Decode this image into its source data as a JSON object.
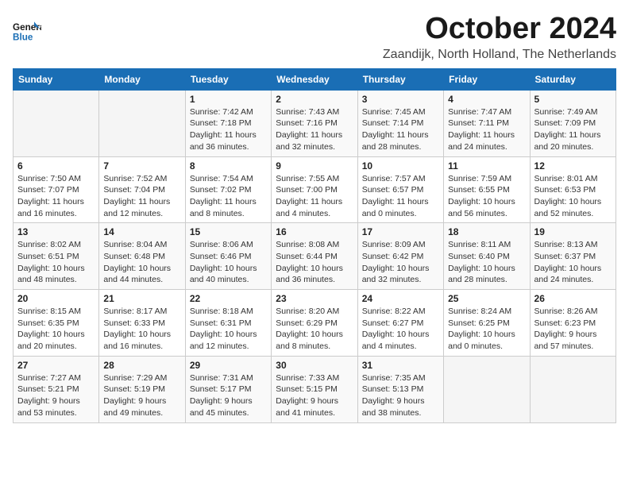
{
  "logo": {
    "line1": "General",
    "line2": "Blue"
  },
  "title": "October 2024",
  "location": "Zaandijk, North Holland, The Netherlands",
  "headers": [
    "Sunday",
    "Monday",
    "Tuesday",
    "Wednesday",
    "Thursday",
    "Friday",
    "Saturday"
  ],
  "weeks": [
    [
      {
        "day": "",
        "info": ""
      },
      {
        "day": "",
        "info": ""
      },
      {
        "day": "1",
        "info": "Sunrise: 7:42 AM\nSunset: 7:18 PM\nDaylight: 11 hours\nand 36 minutes."
      },
      {
        "day": "2",
        "info": "Sunrise: 7:43 AM\nSunset: 7:16 PM\nDaylight: 11 hours\nand 32 minutes."
      },
      {
        "day": "3",
        "info": "Sunrise: 7:45 AM\nSunset: 7:14 PM\nDaylight: 11 hours\nand 28 minutes."
      },
      {
        "day": "4",
        "info": "Sunrise: 7:47 AM\nSunset: 7:11 PM\nDaylight: 11 hours\nand 24 minutes."
      },
      {
        "day": "5",
        "info": "Sunrise: 7:49 AM\nSunset: 7:09 PM\nDaylight: 11 hours\nand 20 minutes."
      }
    ],
    [
      {
        "day": "6",
        "info": "Sunrise: 7:50 AM\nSunset: 7:07 PM\nDaylight: 11 hours\nand 16 minutes."
      },
      {
        "day": "7",
        "info": "Sunrise: 7:52 AM\nSunset: 7:04 PM\nDaylight: 11 hours\nand 12 minutes."
      },
      {
        "day": "8",
        "info": "Sunrise: 7:54 AM\nSunset: 7:02 PM\nDaylight: 11 hours\nand 8 minutes."
      },
      {
        "day": "9",
        "info": "Sunrise: 7:55 AM\nSunset: 7:00 PM\nDaylight: 11 hours\nand 4 minutes."
      },
      {
        "day": "10",
        "info": "Sunrise: 7:57 AM\nSunset: 6:57 PM\nDaylight: 11 hours\nand 0 minutes."
      },
      {
        "day": "11",
        "info": "Sunrise: 7:59 AM\nSunset: 6:55 PM\nDaylight: 10 hours\nand 56 minutes."
      },
      {
        "day": "12",
        "info": "Sunrise: 8:01 AM\nSunset: 6:53 PM\nDaylight: 10 hours\nand 52 minutes."
      }
    ],
    [
      {
        "day": "13",
        "info": "Sunrise: 8:02 AM\nSunset: 6:51 PM\nDaylight: 10 hours\nand 48 minutes."
      },
      {
        "day": "14",
        "info": "Sunrise: 8:04 AM\nSunset: 6:48 PM\nDaylight: 10 hours\nand 44 minutes."
      },
      {
        "day": "15",
        "info": "Sunrise: 8:06 AM\nSunset: 6:46 PM\nDaylight: 10 hours\nand 40 minutes."
      },
      {
        "day": "16",
        "info": "Sunrise: 8:08 AM\nSunset: 6:44 PM\nDaylight: 10 hours\nand 36 minutes."
      },
      {
        "day": "17",
        "info": "Sunrise: 8:09 AM\nSunset: 6:42 PM\nDaylight: 10 hours\nand 32 minutes."
      },
      {
        "day": "18",
        "info": "Sunrise: 8:11 AM\nSunset: 6:40 PM\nDaylight: 10 hours\nand 28 minutes."
      },
      {
        "day": "19",
        "info": "Sunrise: 8:13 AM\nSunset: 6:37 PM\nDaylight: 10 hours\nand 24 minutes."
      }
    ],
    [
      {
        "day": "20",
        "info": "Sunrise: 8:15 AM\nSunset: 6:35 PM\nDaylight: 10 hours\nand 20 minutes."
      },
      {
        "day": "21",
        "info": "Sunrise: 8:17 AM\nSunset: 6:33 PM\nDaylight: 10 hours\nand 16 minutes."
      },
      {
        "day": "22",
        "info": "Sunrise: 8:18 AM\nSunset: 6:31 PM\nDaylight: 10 hours\nand 12 minutes."
      },
      {
        "day": "23",
        "info": "Sunrise: 8:20 AM\nSunset: 6:29 PM\nDaylight: 10 hours\nand 8 minutes."
      },
      {
        "day": "24",
        "info": "Sunrise: 8:22 AM\nSunset: 6:27 PM\nDaylight: 10 hours\nand 4 minutes."
      },
      {
        "day": "25",
        "info": "Sunrise: 8:24 AM\nSunset: 6:25 PM\nDaylight: 10 hours\nand 0 minutes."
      },
      {
        "day": "26",
        "info": "Sunrise: 8:26 AM\nSunset: 6:23 PM\nDaylight: 9 hours\nand 57 minutes."
      }
    ],
    [
      {
        "day": "27",
        "info": "Sunrise: 7:27 AM\nSunset: 5:21 PM\nDaylight: 9 hours\nand 53 minutes."
      },
      {
        "day": "28",
        "info": "Sunrise: 7:29 AM\nSunset: 5:19 PM\nDaylight: 9 hours\nand 49 minutes."
      },
      {
        "day": "29",
        "info": "Sunrise: 7:31 AM\nSunset: 5:17 PM\nDaylight: 9 hours\nand 45 minutes."
      },
      {
        "day": "30",
        "info": "Sunrise: 7:33 AM\nSunset: 5:15 PM\nDaylight: 9 hours\nand 41 minutes."
      },
      {
        "day": "31",
        "info": "Sunrise: 7:35 AM\nSunset: 5:13 PM\nDaylight: 9 hours\nand 38 minutes."
      },
      {
        "day": "",
        "info": ""
      },
      {
        "day": "",
        "info": ""
      }
    ]
  ]
}
